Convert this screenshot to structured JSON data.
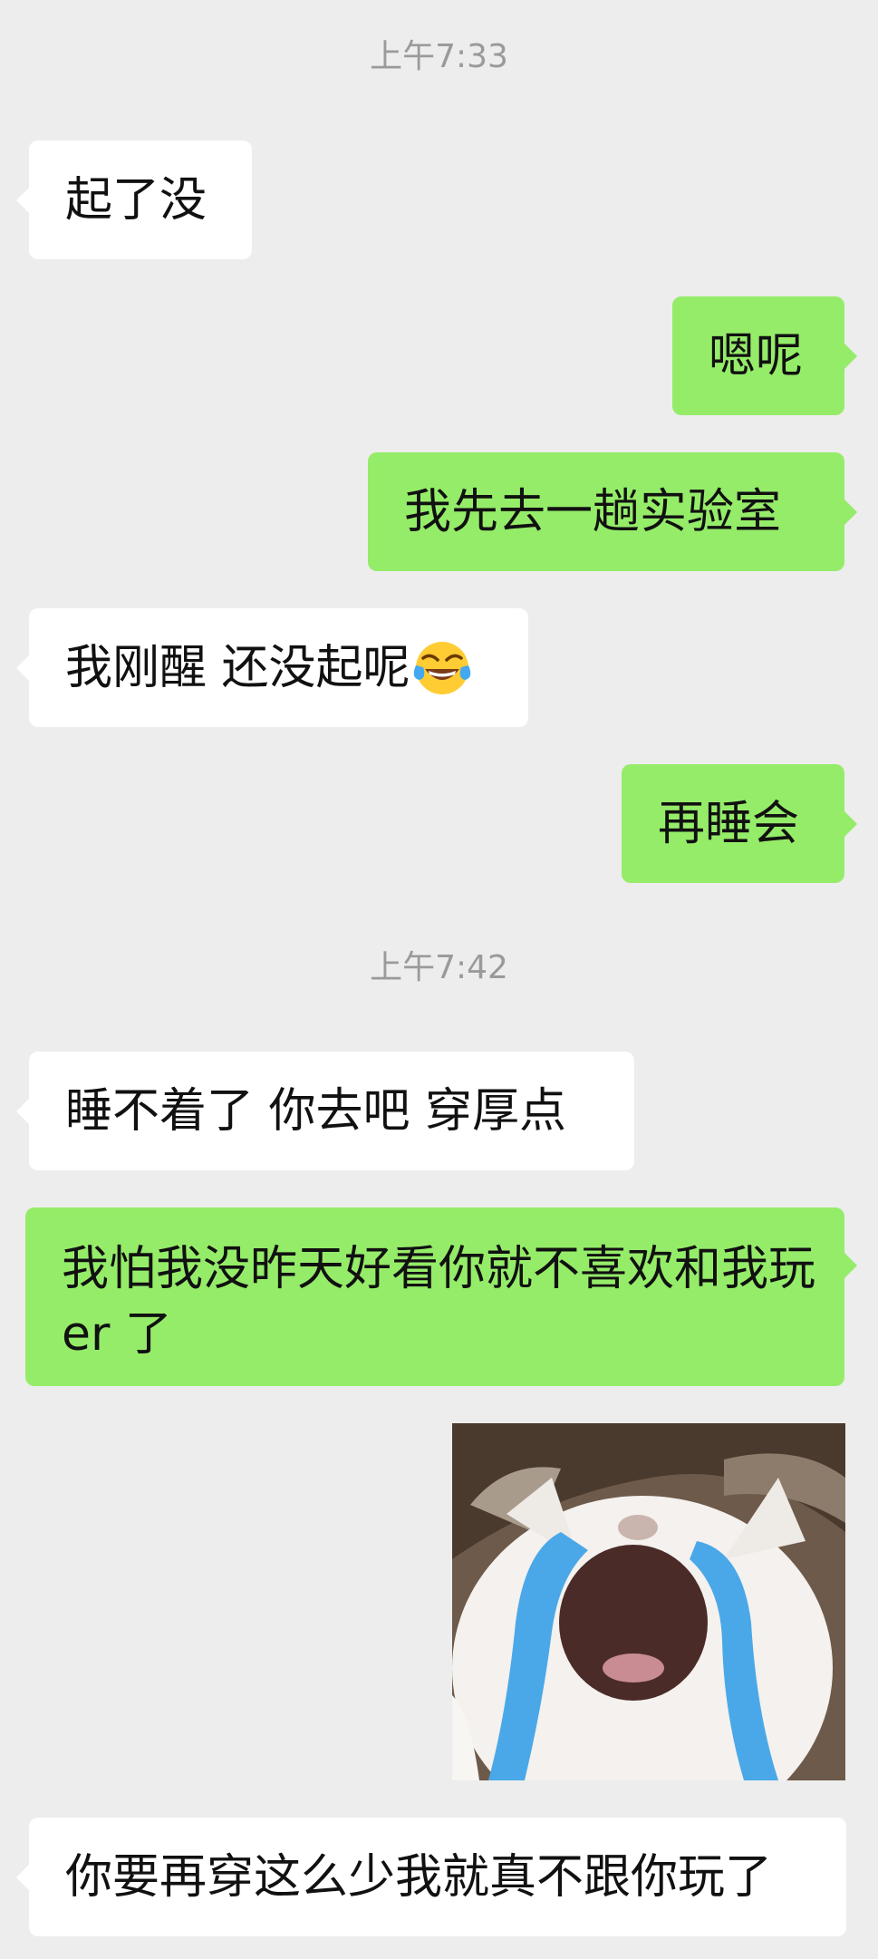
{
  "chat": {
    "timestamps": [
      "上午7:33",
      "上午7:42"
    ],
    "messages": [
      {
        "side": "left",
        "text": "起了没"
      },
      {
        "side": "right",
        "text": "嗯呢"
      },
      {
        "side": "right",
        "text": "我先去一趟实验室"
      },
      {
        "side": "left",
        "text": "我刚醒 还没起呢",
        "emoji": "tears-of-joy-emoji"
      },
      {
        "side": "right",
        "text": "再睡会"
      },
      {
        "side": "left",
        "text": "睡不着了 你去吧 穿厚点"
      },
      {
        "side": "right",
        "text": "我怕我没昨天好看你就不喜欢和我玩 er 了"
      },
      {
        "side": "right",
        "sticker": "crying-cat-sticker"
      },
      {
        "side": "left",
        "text": "你要再穿这么少我就真不跟你玩了"
      }
    ]
  },
  "colors": {
    "background": "#ededed",
    "incoming_bubble": "#ffffff",
    "outgoing_bubble": "#95ec69",
    "timestamp_text": "#9a9a9a",
    "message_text": "#111111"
  }
}
